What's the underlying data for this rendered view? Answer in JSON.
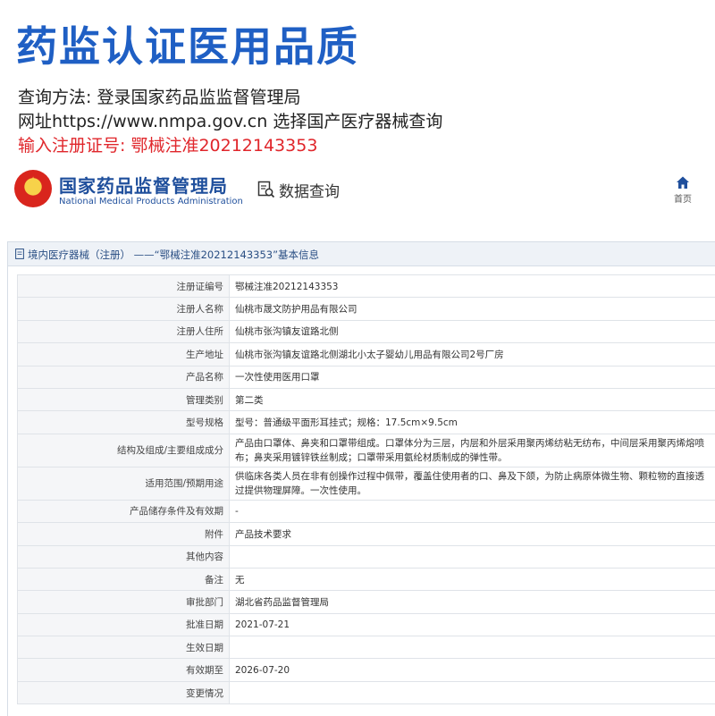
{
  "title": "药监认证医用品质",
  "instructions": {
    "line1": "查询方法: 登录国家药品监监督管理局",
    "line2": "网址https://www.nmpa.gov.cn 选择国产医疗器械查询",
    "line3": "输入注册证号: 鄂械注准20212143353"
  },
  "agency": {
    "name_cn": "国家药品监督管理局",
    "name_en": "National Medical Products Administration",
    "data_query": "数据查询",
    "home": "首页"
  },
  "section": {
    "title": "境内医疗器械（注册） ——“鄂械注准20212143353”基本信息"
  },
  "rows": [
    {
      "key": "注册证编号",
      "value": "鄂械注准20212143353"
    },
    {
      "key": "注册人名称",
      "value": "仙桃市晟文防护用品有限公司"
    },
    {
      "key": "注册人住所",
      "value": "仙桃市张沟镇友谊路北侧"
    },
    {
      "key": "生产地址",
      "value": "仙桃市张沟镇友谊路北侧湖北小太子婴幼儿用品有限公司2号厂房"
    },
    {
      "key": "产品名称",
      "value": "一次性使用医用口罩"
    },
    {
      "key": "管理类别",
      "value": "第二类"
    },
    {
      "key": "型号规格",
      "value": "型号：普通级平面形耳挂式；规格：17.5cm×9.5cm"
    },
    {
      "key": "结构及组成/主要组成成分",
      "value": "产品由口罩体、鼻夹和口罩带组成。口罩体分为三层，内层和外层采用聚丙烯纺粘无纺布，中间层采用聚丙烯熔喷布；鼻夹采用镀锌铁丝制成；口罩带采用氨纶材质制成的弹性带。"
    },
    {
      "key": "适用范围/预期用途",
      "value": "供临床各类人员在非有创操作过程中佩带，覆盖住使用者的口、鼻及下颌，为防止病原体微生物、颗粒物的直接透过提供物理屏障。一次性使用。"
    },
    {
      "key": "产品储存条件及有效期",
      "value": "-"
    },
    {
      "key": "附件",
      "value": "产品技术要求"
    },
    {
      "key": "其他内容",
      "value": ""
    },
    {
      "key": "备注",
      "value": "无"
    },
    {
      "key": "审批部门",
      "value": "湖北省药品监督管理局"
    },
    {
      "key": "批准日期",
      "value": "2021-07-21"
    },
    {
      "key": "生效日期",
      "value": ""
    },
    {
      "key": "有效期至",
      "value": "2026-07-20"
    },
    {
      "key": "变更情况",
      "value": ""
    }
  ],
  "colors": {
    "title_blue": "#1f5fc4",
    "highlight_red": "#e0262b",
    "agency_blue": "#1f4f9c"
  }
}
